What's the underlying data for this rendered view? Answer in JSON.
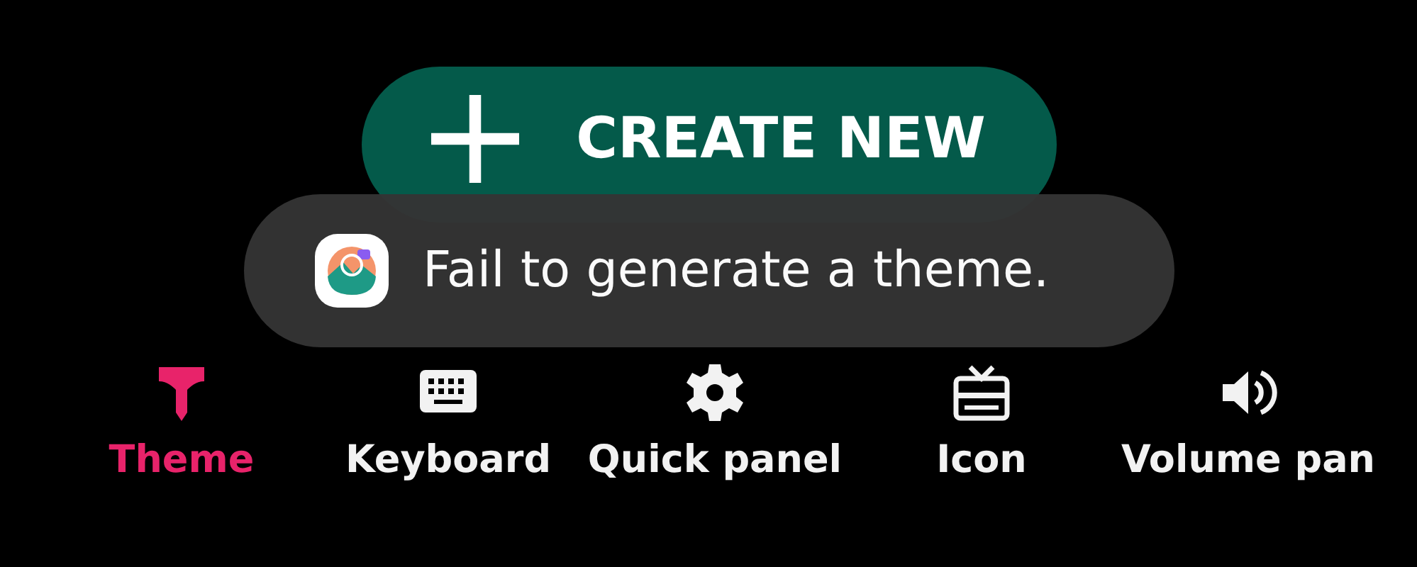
{
  "create_button": {
    "label": "CREATE NEW"
  },
  "toast": {
    "message": "Fail to generate a theme."
  },
  "tabs": [
    {
      "label": "Theme",
      "kind": "theme",
      "selected": true
    },
    {
      "label": "Keyboard",
      "kind": "keyboard",
      "selected": false
    },
    {
      "label": "Quick panel",
      "kind": "quick",
      "selected": false
    },
    {
      "label": "Icon",
      "kind": "icon",
      "selected": false
    },
    {
      "label": "Volume pan",
      "kind": "volume",
      "selected": false
    }
  ]
}
